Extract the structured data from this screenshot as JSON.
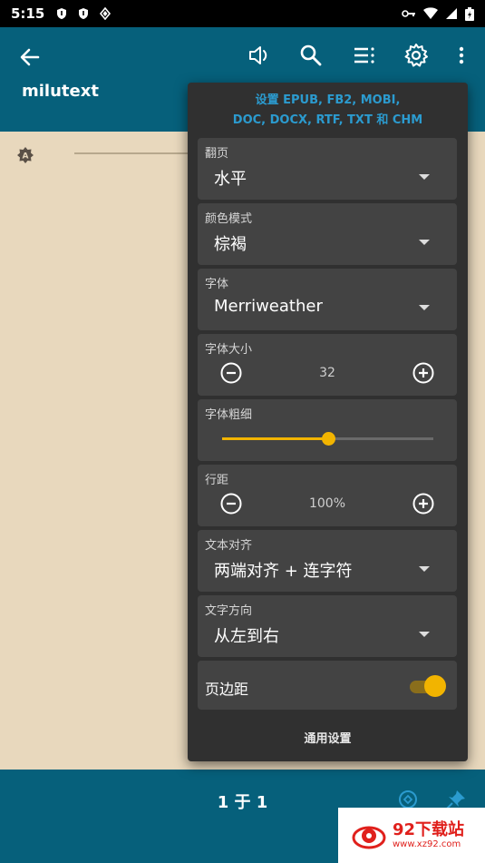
{
  "status": {
    "time": "5:15"
  },
  "appbar": {
    "title": "milutext"
  },
  "popup": {
    "header_line1": "设置 EPUB, FB2, MOBI,",
    "header_line2": "DOC, DOCX, RTF, TXT 和 CHM",
    "page_turn": {
      "label": "翻页",
      "value": "水平"
    },
    "color_mode": {
      "label": "颜色模式",
      "value": "棕褐"
    },
    "font": {
      "label": "字体",
      "value": "Merriweather"
    },
    "font_size": {
      "label": "字体大小",
      "value": "32"
    },
    "font_weight": {
      "label": "字体粗细",
      "level": 0.5
    },
    "line_spacing": {
      "label": "行距",
      "value": "100%"
    },
    "text_align": {
      "label": "文本对齐",
      "value": "两端对齐 + 连字符"
    },
    "text_direction": {
      "label": "文字方向",
      "value": "从左到右"
    },
    "margins": {
      "label": "页边距",
      "enabled": true
    },
    "footer": "通用设置"
  },
  "bottombar": {
    "page_indicator": "1 于 1"
  },
  "watermark": {
    "name": "92下载站",
    "url": "www.xz92.com"
  },
  "colors": {
    "appbar": "#06607b",
    "accent": "#f2b400",
    "link": "#2b9bcf",
    "reader_bg": "#e8d8bd"
  }
}
